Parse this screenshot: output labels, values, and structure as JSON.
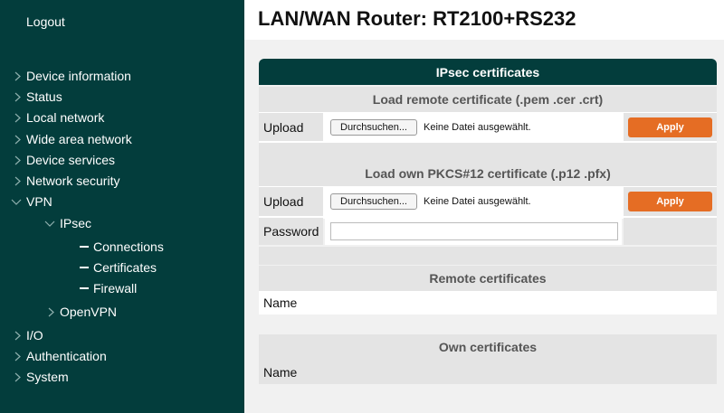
{
  "sidebar": {
    "logout": "Logout",
    "items": [
      {
        "label": "Device information"
      },
      {
        "label": "Status"
      },
      {
        "label": "Local network"
      },
      {
        "label": "Wide area network"
      },
      {
        "label": "Device services"
      },
      {
        "label": "Network security"
      },
      {
        "label": "VPN"
      },
      {
        "label": "IPsec"
      },
      {
        "label": "Connections"
      },
      {
        "label": "Certificates"
      },
      {
        "label": "Firewall"
      },
      {
        "label": "OpenVPN"
      },
      {
        "label": "I/O"
      },
      {
        "label": "Authentication"
      },
      {
        "label": "System"
      }
    ]
  },
  "header": {
    "title": "LAN/WAN Router: RT2100+RS232"
  },
  "panel": {
    "title": "IPsec certificates",
    "remote_load": {
      "heading": "Load remote certificate (.pem .cer .crt)",
      "upload_label": "Upload",
      "browse_label": "Durchsuchen...",
      "file_status": "Keine Datei ausgewählt.",
      "apply_label": "Apply"
    },
    "own_load": {
      "heading": "Load own PKCS#12 certificate (.p12 .pfx)",
      "upload_label": "Upload",
      "browse_label": "Durchsuchen...",
      "file_status": "Keine Datei ausgewählt.",
      "apply_label": "Apply",
      "password_label": "Password",
      "password_value": ""
    },
    "remote_list": {
      "heading": "Remote certificates",
      "name_header": "Name"
    },
    "own_list": {
      "heading": "Own certificates",
      "name_header": "Name"
    }
  }
}
